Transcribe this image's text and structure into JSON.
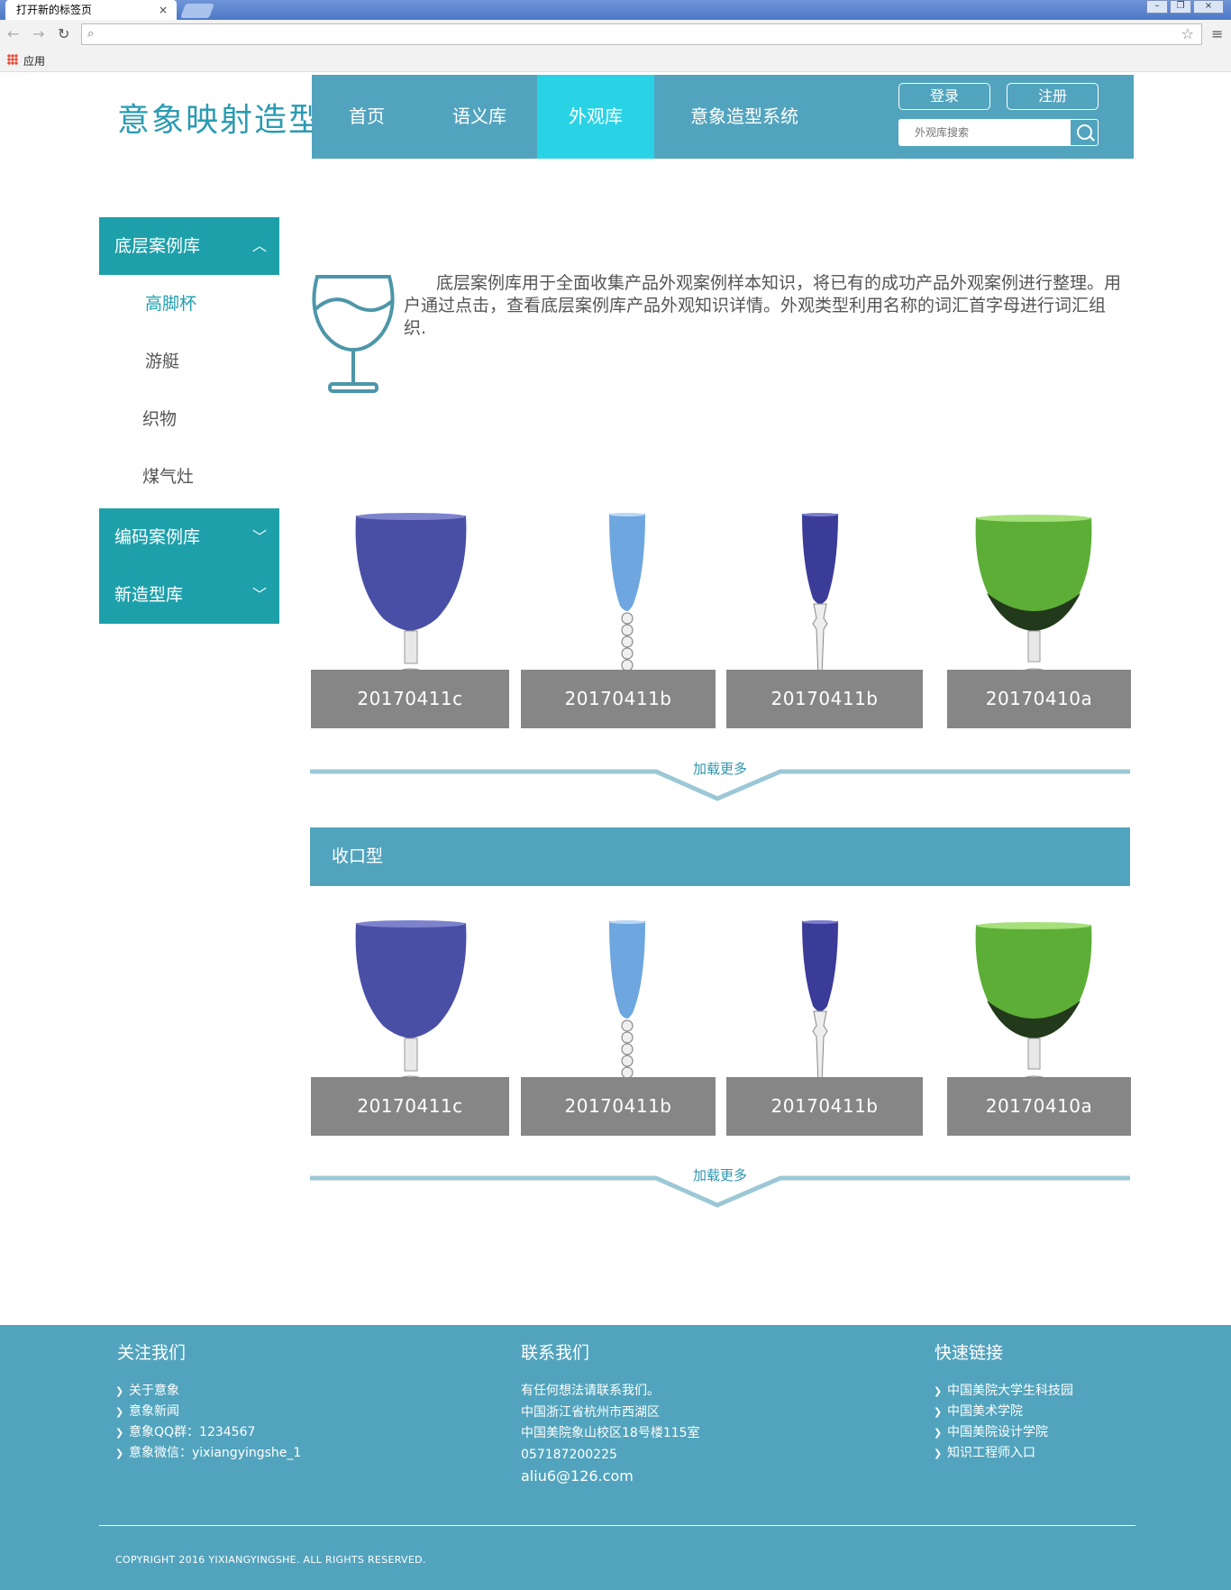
{
  "browser": {
    "tab_title": "打开新的标签页",
    "tab_close": "×",
    "apps_label": "应用",
    "window_controls": [
      "–",
      "❐",
      "×"
    ]
  },
  "site": {
    "logo": "意象映射造型",
    "nav": [
      "首页",
      "语义库",
      "外观库",
      "意象造型系统"
    ],
    "active_nav": "外观库",
    "login": "登录",
    "register": "注册",
    "search_placeholder": "外观库搜索"
  },
  "sidebar": {
    "groups": [
      {
        "label": "底层案例库",
        "expanded": true,
        "items": [
          "高脚杯",
          "游艇",
          "织物",
          "煤气灶"
        ],
        "current": "高脚杯"
      },
      {
        "label": "编码案例库",
        "expanded": false
      },
      {
        "label": "新造型库",
        "expanded": false
      }
    ]
  },
  "intro": {
    "text": "底层案例库用于全面收集产品外观案例样本知识，将已有的成功产品外观案例进行整理。用户通过点击，查看底层案例库产品外观知识详情。外观类型利用名称的词汇首字母进行词汇组织."
  },
  "gallery_top": {
    "items": [
      {
        "code": "20170411c",
        "glass": "goblet-blue"
      },
      {
        "code": "20170411b",
        "glass": "flute-lightblue"
      },
      {
        "code": "20170411b",
        "glass": "flute-navy"
      },
      {
        "code": "20170410a",
        "glass": "goblet-green"
      }
    ],
    "load_more": "加载更多"
  },
  "section": {
    "title": "收口型",
    "items": [
      {
        "code": "20170411c",
        "glass": "goblet-blue"
      },
      {
        "code": "20170411b",
        "glass": "flute-lightblue"
      },
      {
        "code": "20170411b",
        "glass": "flute-navy"
      },
      {
        "code": "20170410a",
        "glass": "goblet-green"
      }
    ],
    "load_more": "加载更多"
  },
  "footer": {
    "follow": {
      "title": "关注我们",
      "items": [
        "关于意象",
        "意象新闻",
        "意象QQ群：1234567",
        "意象微信：yixiangyingshe_1"
      ]
    },
    "contact": {
      "title": "联系我们",
      "lines": [
        "有任何想法请联系我们。",
        "中国浙江省杭州市西湖区",
        "中国美院象山校区18号楼115室",
        "057187200225",
        "aliu6@126.com"
      ]
    },
    "links": {
      "title": "快速链接",
      "items": [
        "中国美院大学生科技园",
        "中国美术学院",
        "中国美院设计学院",
        "知识工程师入口"
      ]
    },
    "copyright": "COPYRIGHT 2016 YIXIANGYINGSHE. ALL RIGHTS RESERVED."
  },
  "colors": {
    "nav_bg": "#52a4be",
    "nav_active": "#29d3e5",
    "sidebar_bg": "#1ea0ab",
    "accent_text": "#1e9fb0",
    "card_label_bg": "#868686"
  }
}
